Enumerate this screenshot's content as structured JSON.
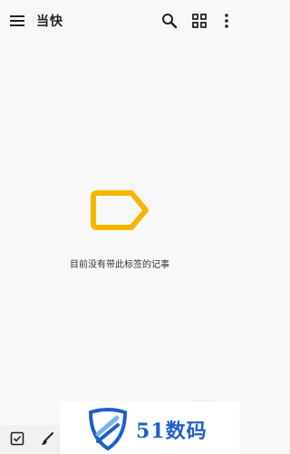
{
  "app": {
    "title": "当快"
  },
  "toolbar": {
    "menu_icon": "hamburger-menu-icon",
    "search_icon": "search-icon",
    "layout_icon": "grid-view-icon",
    "more_icon": "more-vert-icon"
  },
  "empty_state": {
    "illustration": "label-icon",
    "illustration_color": "#f6b600",
    "message": "目前没有带此标签的记事"
  },
  "bottom_bar": {
    "checkbox_icon": "new-list-icon",
    "brush_icon": "new-drawing-icon"
  },
  "watermark": {
    "text": "51数码",
    "color": "#1f5fc9"
  }
}
